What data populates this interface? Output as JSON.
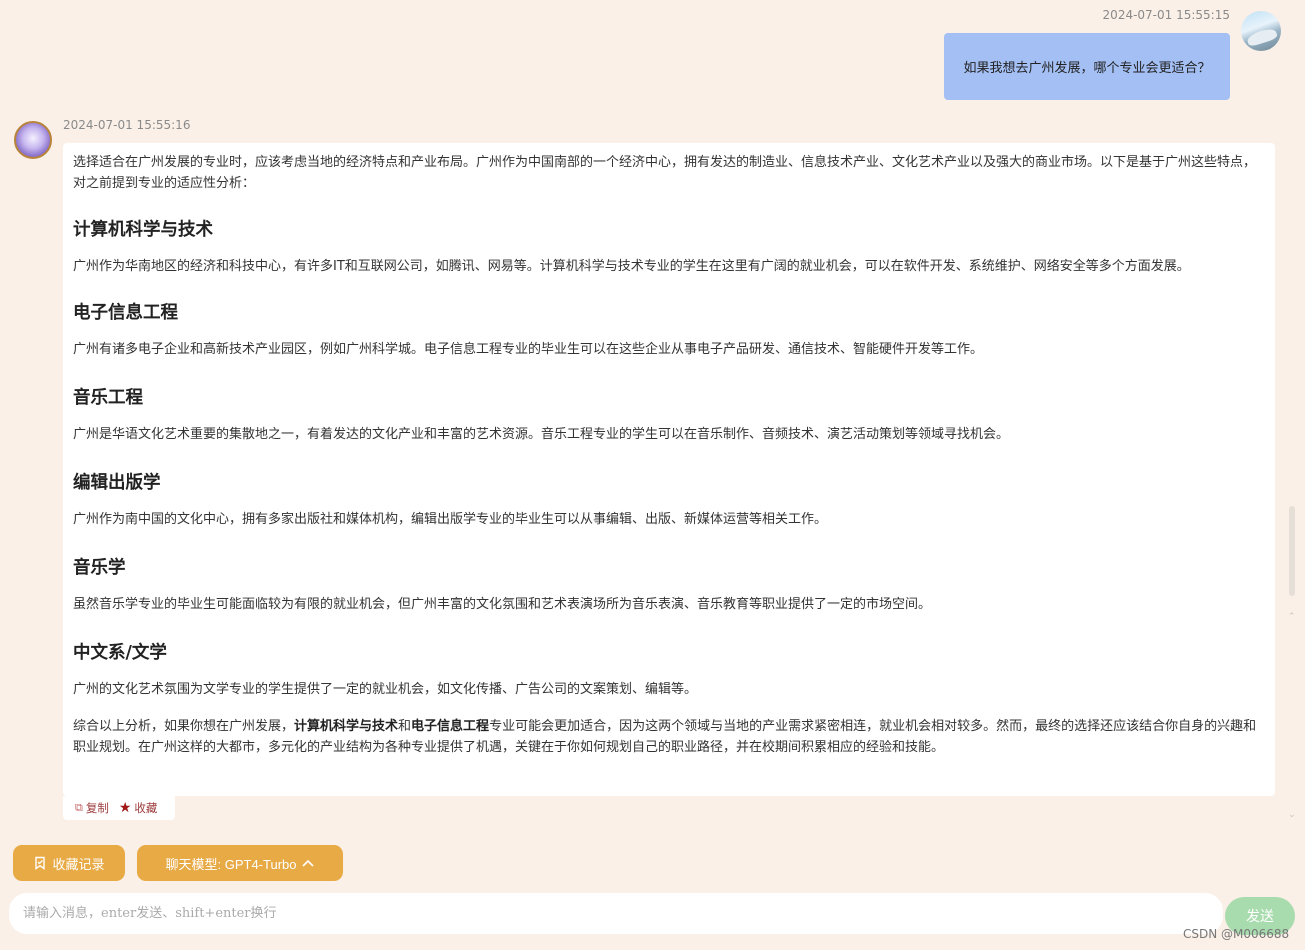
{
  "user_message": {
    "timestamp": "2024-07-01 15:55:15",
    "text": "如果我想去广州发展，哪个专业会更适合？"
  },
  "assistant_message": {
    "timestamp": "2024-07-01 15:55:16",
    "intro": "选择适合在广州发展的专业时，应该考虑当地的经济特点和产业布局。广州作为中国南部的一个经济中心，拥有发达的制造业、信息技术产业、文化艺术产业以及强大的商业市场。以下是基于广州这些特点，对之前提到专业的适应性分析：",
    "sections": [
      {
        "heading": "计算机科学与技术",
        "body": "广州作为华南地区的经济和科技中心，有许多IT和互联网公司，如腾讯、网易等。计算机科学与技术专业的学生在这里有广阔的就业机会，可以在软件开发、系统维护、网络安全等多个方面发展。"
      },
      {
        "heading": "电子信息工程",
        "body": "广州有诸多电子企业和高新技术产业园区，例如广州科学城。电子信息工程专业的毕业生可以在这些企业从事电子产品研发、通信技术、智能硬件开发等工作。"
      },
      {
        "heading": "音乐工程",
        "body": "广州是华语文化艺术重要的集散地之一，有着发达的文化产业和丰富的艺术资源。音乐工程专业的学生可以在音乐制作、音频技术、演艺活动策划等领域寻找机会。"
      },
      {
        "heading": "编辑出版学",
        "body": "广州作为南中国的文化中心，拥有多家出版社和媒体机构，编辑出版学专业的毕业生可以从事编辑、出版、新媒体运营等相关工作。"
      },
      {
        "heading": "音乐学",
        "body": "虽然音乐学专业的毕业生可能面临较为有限的就业机会，但广州丰富的文化氛围和艺术表演场所为音乐表演、音乐教育等职业提供了一定的市场空间。"
      },
      {
        "heading": "中文系/文学",
        "body": "广州的文化艺术氛围为文学专业的学生提供了一定的就业机会，如文化传播、广告公司的文案策划、编辑等。"
      }
    ],
    "conclusion": {
      "part1": "综合以上分析，如果你想在广州发展，",
      "bold1": "计算机科学与技术",
      "part2": "和",
      "bold2": "电子信息工程",
      "part3": "专业可能会更加适合，因为这两个领域与当地的产业需求紧密相连，就业机会相对较多。然而，最终的选择还应该结合你自身的兴趣和职业规划。在广州这样的大都市，多元化的产业结构为各种专业提供了机遇，关键在于你如何规划自己的职业路径，并在校期间积累相应的经验和技能。"
    },
    "actions": {
      "copy": "复制",
      "favorite": "收藏"
    }
  },
  "controls": {
    "favorites_button": "收藏记录",
    "model_button": "聊天模型: GPT4-Turbo",
    "input_placeholder": "请输入消息，enter发送、shift+enter换行",
    "send_button": "发送"
  },
  "watermark": "CSDN @M006688"
}
